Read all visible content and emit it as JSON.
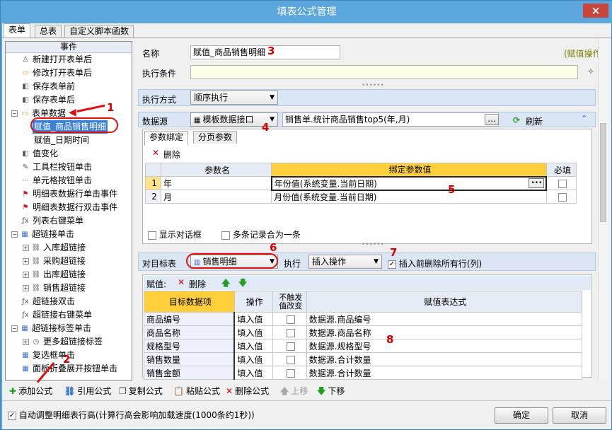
{
  "window": {
    "title": "填表公式管理",
    "close": "×"
  },
  "tabs": [
    "表单",
    "总表",
    "自定义脚本函数"
  ],
  "left": {
    "header": "事件",
    "items": [
      {
        "label": "新建打开表单后",
        "icon": "new-form-icon",
        "glyph": "♙"
      },
      {
        "label": "修改打开表单后",
        "icon": "folder-icon",
        "glyph": "▭"
      },
      {
        "label": "保存表单前",
        "icon": "save-icon",
        "glyph": "◧"
      },
      {
        "label": "保存表单后",
        "icon": "save-icon",
        "glyph": "◧"
      },
      {
        "label": "表单数据",
        "icon": "folder-open-icon",
        "glyph": "▭"
      },
      {
        "label": "赋值_商品销售明细",
        "icon": "none",
        "glyph": ""
      },
      {
        "label": "赋值_日期时间",
        "icon": "none",
        "glyph": ""
      },
      {
        "label": "值变化",
        "icon": "value-change-icon",
        "glyph": "◧"
      },
      {
        "label": "工具栏按钮单击",
        "icon": "toolbar-icon",
        "glyph": "✎"
      },
      {
        "label": "单元格按钮单击",
        "icon": "cell-button-icon",
        "glyph": "⋯"
      },
      {
        "label": "明细表数据行单击事件",
        "icon": "flag-icon",
        "glyph": "⚑"
      },
      {
        "label": "明细表数据行双击事件",
        "icon": "flag-icon",
        "glyph": "⚑"
      },
      {
        "label": "列表右键菜单",
        "icon": "function-icon",
        "glyph": "ƒx"
      },
      {
        "label": "超链接单击",
        "icon": "table-icon",
        "glyph": "▦"
      },
      {
        "label": "入库超链接",
        "icon": "link-icon",
        "glyph": "⛓"
      },
      {
        "label": "采购超链接",
        "icon": "link-icon",
        "glyph": "⛓"
      },
      {
        "label": "出库超链接",
        "icon": "link-icon",
        "glyph": "⛓"
      },
      {
        "label": "销售超链接",
        "icon": "link-icon",
        "glyph": "⛓"
      },
      {
        "label": "超链接双击",
        "icon": "function-icon",
        "glyph": "ƒx"
      },
      {
        "label": "超链接右键菜单",
        "icon": "function-icon",
        "glyph": "ƒx"
      },
      {
        "label": "超链接标签单击",
        "icon": "table-icon",
        "glyph": "▦"
      },
      {
        "label": "更多超链接标签",
        "icon": "clock-icon",
        "glyph": "◷"
      },
      {
        "label": "复选框单击",
        "icon": "table-icon",
        "glyph": "▦"
      },
      {
        "label": "面板折叠展开按钮单击",
        "icon": "table-icon",
        "glyph": "▦"
      }
    ]
  },
  "form": {
    "name_label": "名称",
    "name_value": "赋值_商品销售明细",
    "action_type": "(赋值操作)",
    "condition_label": "执行条件",
    "exec_mode_label": "执行方式",
    "exec_mode_value": "顺序执行",
    "datasource_label": "数据源",
    "datasource_type": "模板数据接口",
    "datasource_value": "销售单.统计商品销售top5(年,月)",
    "browse": "...",
    "refresh": "刷新"
  },
  "param_tabs": [
    "参数绑定",
    "分页参数"
  ],
  "param_delete": "删除",
  "param_grid": {
    "headers": [
      "参数名",
      "绑定参数值",
      "必填"
    ],
    "rows": [
      {
        "no": "1",
        "name": "年",
        "value": "年份值(系统变量.当前日期)"
      },
      {
        "no": "2",
        "name": "月",
        "value": "月份值(系统变量.当前日期)"
      }
    ]
  },
  "param_options": [
    "显示对话框",
    "多条记录合为一条"
  ],
  "target": {
    "label": "对目标表",
    "table": "销售明细",
    "exec_label": "执行",
    "exec_value": "插入操作",
    "clear_label": "插入前删除所有行(列)"
  },
  "assign": {
    "label": "赋值:",
    "delete": "删除",
    "headers": [
      "目标数据项",
      "操作",
      "不触发值改变",
      "赋值表达式"
    ],
    "rows": [
      {
        "target": "商品编号",
        "op": "填入值",
        "expr": "数据源.商品编号"
      },
      {
        "target": "商品名称",
        "op": "填入值",
        "expr": "数据源.商品名称"
      },
      {
        "target": "规格型号",
        "op": "填入值",
        "expr": "数据源.规格型号"
      },
      {
        "target": "销售数量",
        "op": "填入值",
        "expr": "数据源.合计数量"
      },
      {
        "target": "销售金额",
        "op": "填入值",
        "expr": "数据源.合计数量"
      }
    ]
  },
  "toolbar": [
    "添加公式",
    "引用公式",
    "复制公式",
    "粘贴公式",
    "删除公式",
    "上移",
    "下移"
  ],
  "footer": {
    "auto_adjust": "自动调整明细表行高(计算行高会影响加载速度(1000条约1秒))",
    "ok": "确定",
    "cancel": "取消"
  },
  "annotations": [
    "1",
    "2",
    "3",
    "4",
    "5",
    "6",
    "7",
    "8"
  ],
  "colors": {
    "title_bar": "#5ba6dc",
    "selected": "#3a7fd5",
    "annotation": "#e01010",
    "highlight_header": "#ffd040"
  }
}
